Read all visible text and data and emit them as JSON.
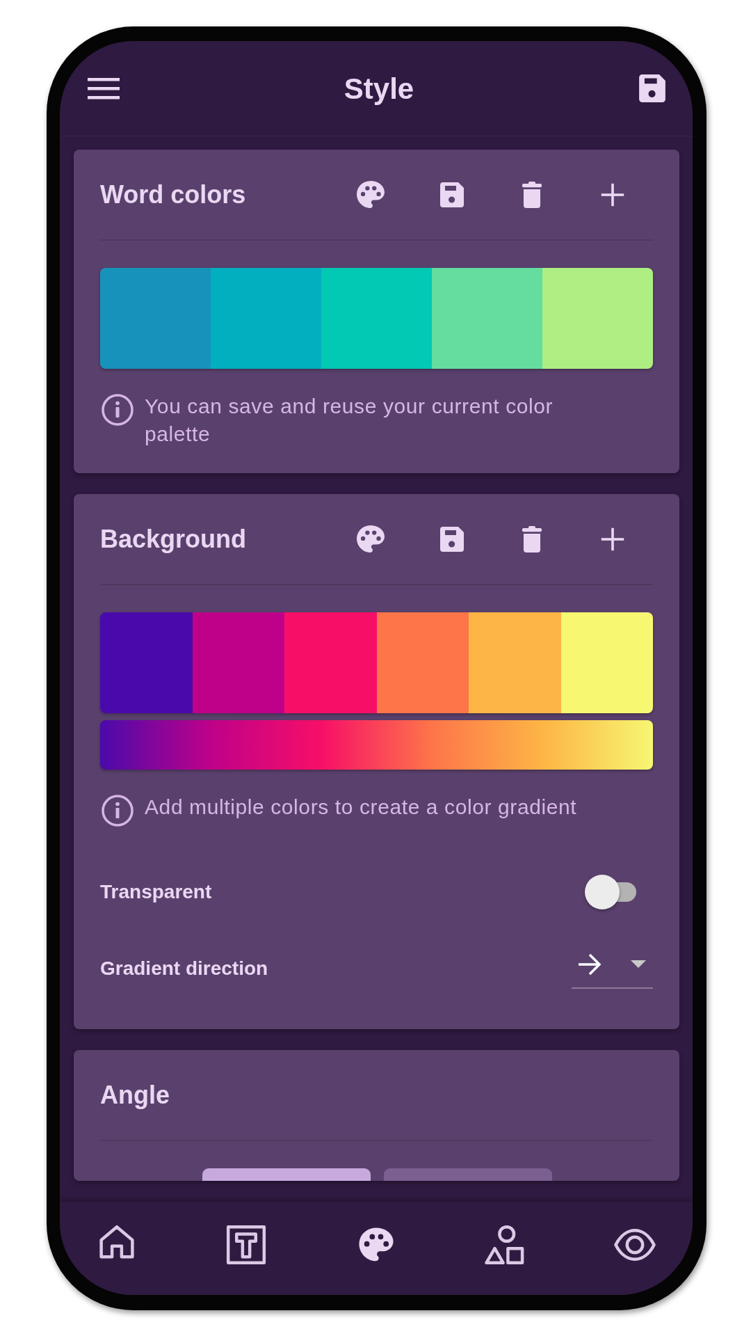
{
  "header": {
    "title": "Style"
  },
  "word_colors": {
    "title": "Word colors",
    "swatches": [
      {
        "color": "#1793bb"
      },
      {
        "color": "#02afbf"
      },
      {
        "color": "#02c9b3"
      },
      {
        "color": "#64dd9f"
      },
      {
        "color": "#aeee82"
      }
    ],
    "info": "You can save and reuse your current color palette"
  },
  "background": {
    "title": "Background",
    "swatches": [
      {
        "color": "#4a0aab"
      },
      {
        "color": "#bf0189"
      },
      {
        "color": "#f70f67"
      },
      {
        "color": "#fd7549"
      },
      {
        "color": "#fdb545"
      },
      {
        "color": "#f7f772"
      }
    ],
    "info": "Add multiple colors to create a color gradient",
    "transparent": {
      "label": "Transparent",
      "on": false
    },
    "direction": {
      "label": "Gradient direction"
    }
  },
  "angle": {
    "title": "Angle",
    "options": [
      {
        "selected": true
      },
      {
        "selected": false
      }
    ]
  },
  "bottom_nav": [
    {
      "kind": "home",
      "selected": false
    },
    {
      "kind": "text",
      "selected": false
    },
    {
      "kind": "palette",
      "selected": true
    },
    {
      "kind": "shapes",
      "selected": false
    },
    {
      "kind": "eye",
      "selected": false
    }
  ]
}
